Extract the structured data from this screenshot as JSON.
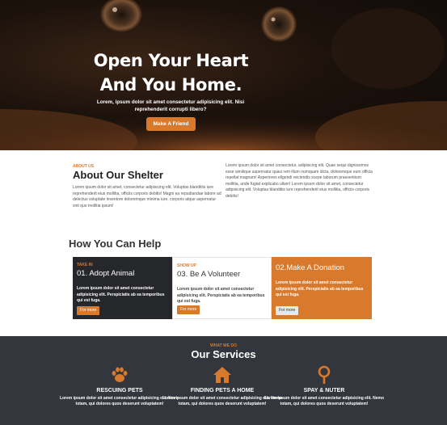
{
  "hero": {
    "title_line1": "Open Your Heart",
    "title_line2": "And You Home.",
    "subtitle": "Lorem, ipsum dolor sit amet consectetur adipisicing elit. Nisi reprehenderit corrupti libero?",
    "button_label": "Make A Friend"
  },
  "about": {
    "kicker": "ABOUT US",
    "title": "About Our Shelter",
    "left_text": "Lorem ipsum dolor sit amet, consectetur adipisicing elit. Voluptas blanditiis iure reprehenderit eius mollitia, officiis corporis debitis! Magni ea repudiandae labore ad delectus voluptate inventore doloremque minima iure, corporis atque aspernatur sint quo mollitia ipsum!",
    "right_text": "Lorem ipsum dolor sit amet consectetur, adipisicing elit. Quae sequi dignissimos esse similique aspernatur quasi rem illum numquam dicta, doloremque eum officia repellat magnam! Asperiores eligendi reiciendis scepe laborum praesentium mollitia, unde fugiat explicabo ullam! Lorem ipsum dolor sit amet, consectetur adipisicing elit. Voluptas blanditiis iure reprehenderit eius mollitia, officiis corporis debitis!"
  },
  "help": {
    "title": "How You Can Help",
    "cards": [
      {
        "kicker": "TAKE IN",
        "title": "01. Adopt Animal",
        "text": "Lorem ipsum dolor sit amet consectetur adipisicing elit. Perspiciatis ab ea temporibus qui est fuga.",
        "button": "For more"
      },
      {
        "kicker": "SHOW UP",
        "title": "03. Be A Volunteer",
        "text": "Lorem ipsum dolor sit amet consectetur adipisicing elit. Perspiciatis ab ea temporibus qui est fuga.",
        "button": "For more"
      },
      {
        "kicker": "",
        "title": "02.Make A Donation",
        "text": "Lorem ipsum dolor sit amet consectetur adipisicing elit. Perspiciatis ab ea temporibus qui est fuga.",
        "button": "For more"
      }
    ]
  },
  "services": {
    "kicker": "WHAT WE DO",
    "title": "Our Services",
    "items": [
      {
        "icon": "paw-icon",
        "name": "RESCUING PETS",
        "text": "Lorem ipsum dolor sit amet consectetur adipisicing elit. Nemo totam, qui dolores quos deserunt voluptatem!"
      },
      {
        "icon": "home-icon",
        "name": "FINDING PETS A HOME",
        "text": "Lorem ipsum dolor sit amet consectetur adipisicing elit. Nemo totam, qui dolores quos deserunt voluptatem!"
      },
      {
        "icon": "neuter-icon",
        "name": "SPAY & NUTER",
        "text": "Lorem ipsum dolor sit amet consectetur adipisicing elit. Nemo totam, qui dolores quos deserunt voluptatem!"
      }
    ]
  },
  "colors": {
    "accent": "#d9792b",
    "dark": "#26272b",
    "services_bg": "#34363d"
  }
}
